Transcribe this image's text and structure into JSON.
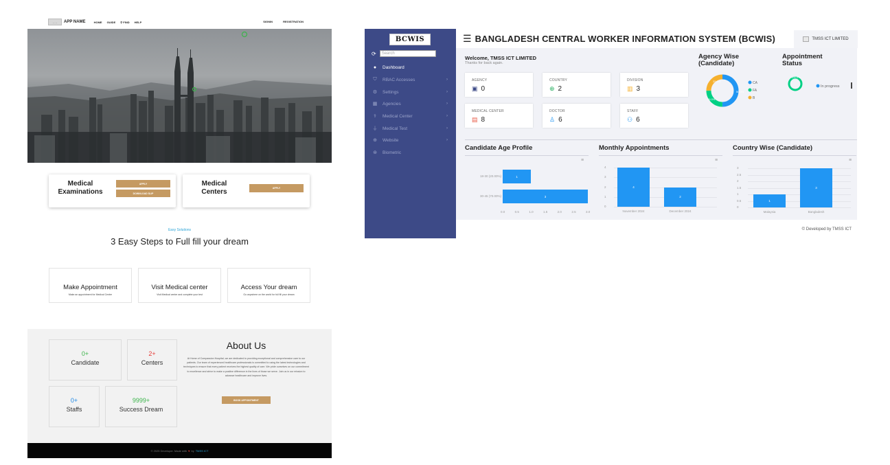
{
  "landing": {
    "nav": {
      "logo_alt": "-- --",
      "app_name": "APP NAME",
      "links": [
        "HOME",
        "GUIDE",
        "FIND",
        "HELP"
      ],
      "signin": "SIGNIN",
      "registration": "REGISTRATION"
    },
    "services": [
      {
        "title_line1": "Medical",
        "title_line2": "Examinations",
        "apply": "APPLY",
        "download": "DOWNLOAD SLIP"
      },
      {
        "title_line1": "Medical",
        "title_line2": "Centers",
        "apply": "APPLY"
      }
    ],
    "easy": {
      "subtitle": "Easy Solutions",
      "title": "3 Easy Steps to Full fill your dream",
      "steps": [
        {
          "title": "Make Appointment",
          "desc": "Make an appointment for Medical Center"
        },
        {
          "title": "Visit Medical center",
          "desc": "Visit Medical center and complete your test"
        },
        {
          "title": "Access Your dream",
          "desc": "Go anywhere on the world for full fill your dream"
        }
      ]
    },
    "stats": [
      {
        "value": "0+",
        "label": "Candidate",
        "color": "#3cb44b"
      },
      {
        "value": "2+",
        "label": "Centers",
        "color": "#e53935"
      },
      {
        "value": "0+",
        "label": "Staffs",
        "color": "#1e88e5"
      },
      {
        "value": "9999+",
        "label": "Success Dream",
        "color": "#3cb44b"
      }
    ],
    "about": {
      "title": "About Us",
      "text": "At Home of Compassion Hospital, we are dedicated to providing exceptional and comprehensive care to our patients. Our team of experienced healthcare professionals is committed to using the latest technologies and techniques to ensure that every patient receives the highest quality of care. We pride ourselves on our commitment to excellence and strive to make a positive difference in the lives of those we serve. Join us in our mission to advance healthcare and improve lives.",
      "button": "BOOK APPOINTMENT"
    },
    "footer": {
      "text": "© 2025 Developer. Made with",
      "by": "by",
      "brand": "TMSS ICT"
    }
  },
  "dashboard": {
    "logo": "BCWIS",
    "title": "BANGLADESH CENTRAL WORKER INFORMATION SYSTEM (BCWIS)",
    "user": "TMSS ICT LIMITED",
    "search_placeholder": "Search",
    "menu": [
      {
        "label": "Dashboard",
        "icon": "info-icon",
        "active": true
      },
      {
        "label": "RBAC Accesses",
        "icon": "shield-icon",
        "active": false
      },
      {
        "label": "Settings",
        "icon": "gear-icon",
        "active": false
      },
      {
        "label": "Agencies",
        "icon": "building-icon",
        "active": false
      },
      {
        "label": "Medical Center",
        "icon": "stethoscope-icon",
        "active": false
      },
      {
        "label": "Medical Test",
        "icon": "vial-icon",
        "active": false
      },
      {
        "label": "Website",
        "icon": "globe-icon",
        "active": false
      },
      {
        "label": "Biometric",
        "icon": "fingerprint-icon",
        "active": false
      }
    ],
    "welcome": "Welcome, TMSS ICT LIMITED",
    "welcome_sub": "Thanks for back again.",
    "kpis": [
      {
        "label": "AGENCY",
        "value": "0",
        "icon": "bus-icon",
        "color": "#3d4a87"
      },
      {
        "label": "COUNTRY",
        "value": "2",
        "icon": "globe-icon",
        "color": "#27ae60"
      },
      {
        "label": "DIVISION",
        "value": "3",
        "icon": "city-icon",
        "color": "#f5b02e"
      },
      {
        "label": "MEDICAL CENTER",
        "value": "8",
        "icon": "hospital-icon",
        "color": "#e85d4a"
      },
      {
        "label": "DOCTOR",
        "value": "6",
        "icon": "doctor-icon",
        "color": "#2196f3"
      },
      {
        "label": "STAFF",
        "value": "6",
        "icon": "users-icon",
        "color": "#2196f3"
      }
    ],
    "colors": {
      "accent": "#2196f3",
      "sidebar": "#3d4a87",
      "content_bg": "#f1f2f7"
    },
    "agency_wise": {
      "title_line1": "Agency Wise",
      "title_line2": "(Candidate)",
      "legend": [
        "CA",
        "FA",
        "B"
      ],
      "legend_colors": [
        "#2196f3",
        "#00d084",
        "#f5b02e"
      ],
      "slice_labels": [
        "50.0%",
        "25.0%",
        "25.0%"
      ]
    },
    "appointment_status": {
      "title_line1": "Appointment",
      "title_line2": "Status",
      "legend": "In progress",
      "slice_label": "100.0%"
    }
  },
  "chart_data": [
    {
      "type": "bar",
      "orientation": "horizontal",
      "title": "Candidate Age Profile",
      "categories": [
        "18-30 (20.00%)",
        "30-45 (70.00%)"
      ],
      "values": [
        1,
        3
      ],
      "xticks": [
        "0.0",
        "0.5",
        "1.0",
        "1.5",
        "2.0",
        "2.5",
        "3.0"
      ],
      "xlim": [
        0,
        3
      ]
    },
    {
      "type": "bar",
      "title": "Monthly Appointments",
      "categories": [
        "November 2024",
        "December 2024"
      ],
      "values": [
        4,
        2
      ],
      "yticks": [
        "0",
        "1",
        "2",
        "3",
        "4"
      ],
      "ylim": [
        0,
        4
      ]
    },
    {
      "type": "bar",
      "title": "Country Wise (Candidate)",
      "categories": [
        "Malaysia",
        "Bangladesh"
      ],
      "values": [
        1,
        3
      ],
      "yticks": [
        "0",
        "0.5",
        "1",
        "1.5",
        "2",
        "2.5",
        "3"
      ],
      "ylim": [
        0,
        3
      ]
    },
    {
      "type": "pie",
      "title": "Agency Wise (Candidate)",
      "categories": [
        "CA",
        "FA",
        "B"
      ],
      "values": [
        50,
        25,
        25
      ]
    },
    {
      "type": "pie",
      "title": "Appointment Status",
      "categories": [
        "In progress"
      ],
      "values": [
        100
      ]
    }
  ],
  "footer": "© Developed by TMSS ICT"
}
